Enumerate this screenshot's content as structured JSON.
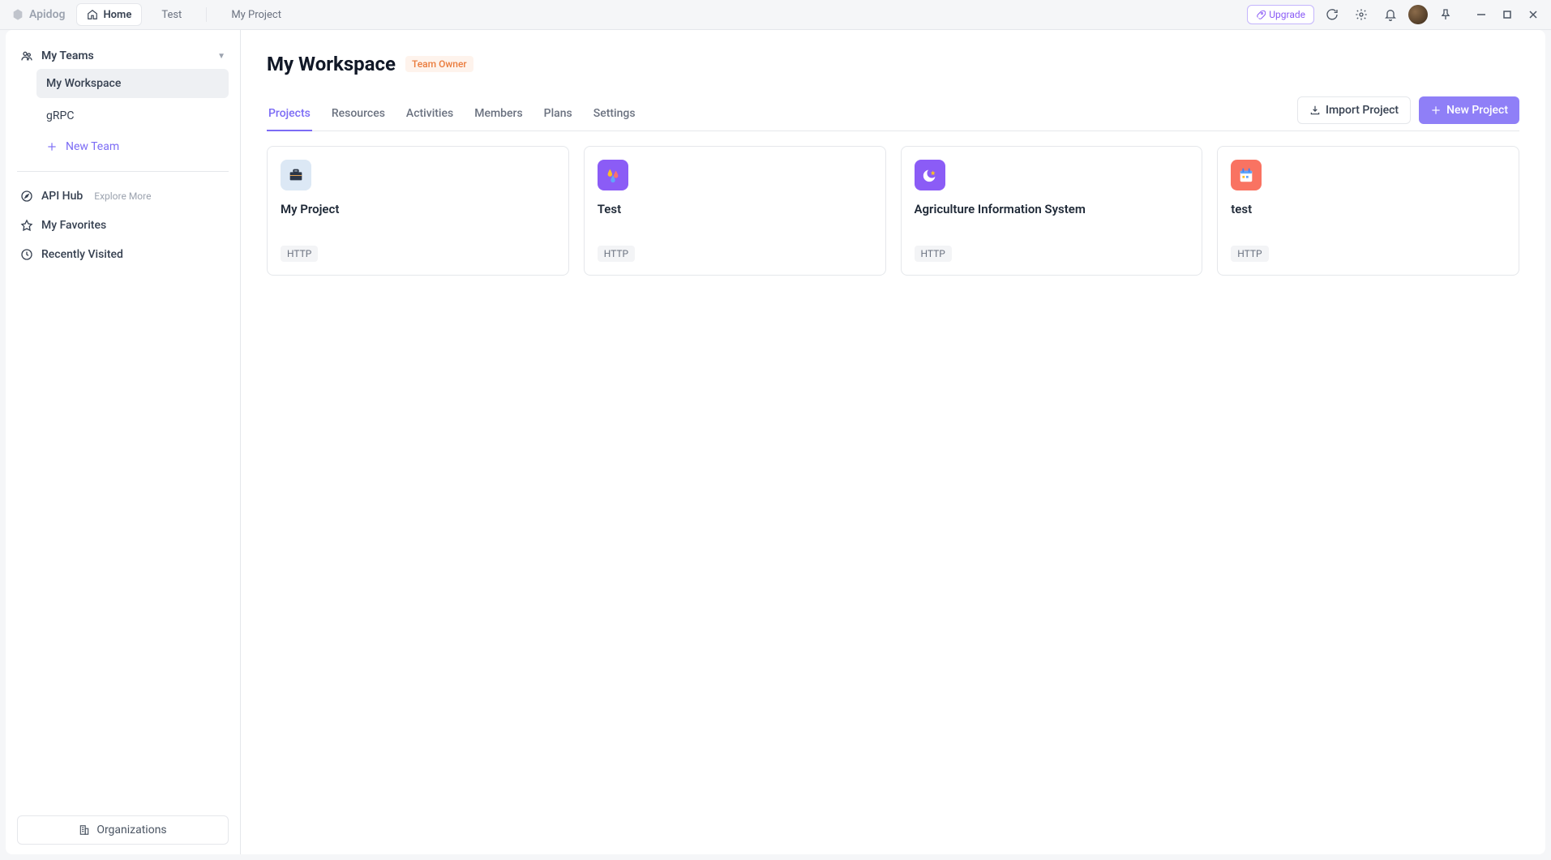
{
  "titlebar": {
    "brand": "Apidog",
    "tabs": [
      {
        "label": "Home",
        "active": true,
        "icon": "home"
      },
      {
        "label": "Test",
        "active": false
      },
      {
        "label": "My Project",
        "active": false
      }
    ],
    "upgrade": "Upgrade"
  },
  "sidebar": {
    "teams_header": "My Teams",
    "teams": [
      {
        "name": "My Workspace",
        "active": true
      },
      {
        "name": "gRPC",
        "active": false
      }
    ],
    "new_team": "New Team",
    "api_hub": {
      "label": "API Hub",
      "hint": "Explore More"
    },
    "favorites": "My Favorites",
    "recent": "Recently Visited",
    "organizations": "Organizations"
  },
  "main": {
    "title": "My Workspace",
    "badge": "Team Owner",
    "tabs": [
      "Projects",
      "Resources",
      "Activities",
      "Members",
      "Plans",
      "Settings"
    ],
    "active_tab": 0,
    "import_btn": "Import Project",
    "new_btn": "New Project",
    "projects": [
      {
        "title": "My Project",
        "type": "HTTP",
        "icon": {
          "bg": "#dce8f5",
          "kind": "briefcase"
        }
      },
      {
        "title": "Test",
        "type": "HTTP",
        "icon": {
          "bg": "#8b5cf6",
          "kind": "drops"
        }
      },
      {
        "title": "Agriculture Information System",
        "type": "HTTP",
        "icon": {
          "bg": "#8b5cf6",
          "kind": "moon"
        }
      },
      {
        "title": "test",
        "type": "HTTP",
        "icon": {
          "bg": "#f97362",
          "kind": "calendar"
        }
      }
    ]
  }
}
